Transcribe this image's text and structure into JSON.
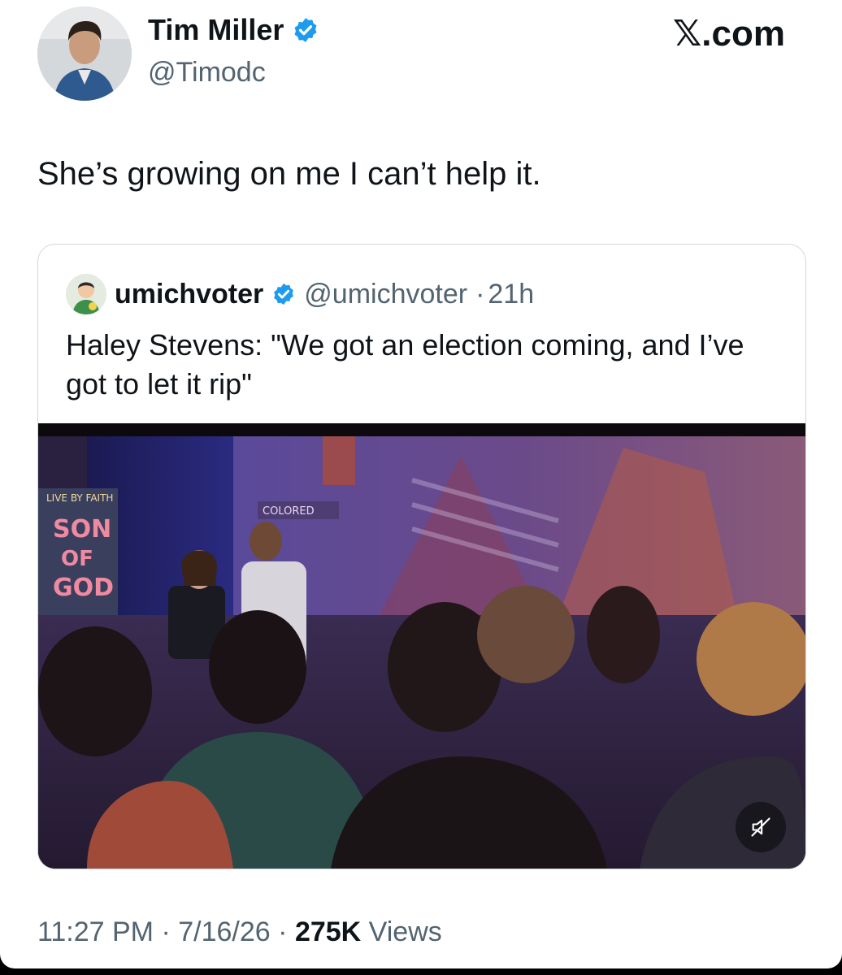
{
  "author": {
    "display_name": "Tim Miller",
    "handle": "@Timodc",
    "verified": true,
    "avatar_icon": "person-avatar"
  },
  "brand": "𝕏.com",
  "tweet": {
    "text": "She’s growing on me I can’t help it."
  },
  "quoted_tweet": {
    "display_name": "umichvoter",
    "handle": "@umichvoter",
    "separator": "·",
    "age": "21h",
    "verified": true,
    "text": "Haley Stevens: \"We got an election coming, and I’ve got to let it rip\"",
    "media": {
      "type": "video",
      "mute_icon": "muted-speaker-icon",
      "banner_lines": [
        "LIVE BY FAITH",
        "SON",
        "OF",
        "GOD"
      ],
      "screen_caption": "COLORED"
    }
  },
  "footer": {
    "time": "11:27 PM",
    "date": "7/16/26",
    "views_count": "275K",
    "views_label": "Views",
    "separator": "·"
  },
  "colors": {
    "text_primary": "#0f1419",
    "text_secondary": "#536471",
    "verified_blue": "#1d9bf0",
    "border": "#cfd9de"
  }
}
